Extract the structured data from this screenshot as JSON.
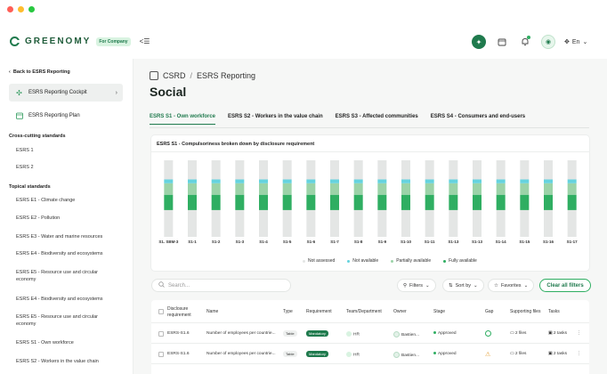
{
  "app": {
    "logo_text": "GREENOMY",
    "plan_badge": "For Company",
    "language": "En",
    "colors": {
      "brand": "#1f7a4d",
      "accent": "#2fae62",
      "light": "#9bd3a8",
      "cyan": "#66d3de",
      "grey": "#e4e6e5"
    }
  },
  "window_controls": {
    "close": "#ff5f57",
    "minimize": "#ffbd2e",
    "maximize": "#28c840"
  },
  "topbar_icons": [
    "ai-assistant-icon",
    "calendar-icon",
    "bell-icon",
    "avatar-icon",
    "globe-icon"
  ],
  "sidebar": {
    "back_label": "Back to ESRS Reporting",
    "cockpit_label": "ESRS Reporting Cockpit",
    "plan_label": "ESRS Reporting Plan",
    "cross_heading": "Cross-cutting standards",
    "cross_items": [
      "ESRS 1",
      "ESRS 2"
    ],
    "topical_heading": "Topical standards",
    "topical_items": [
      "ESRS E1 - Climate change",
      "ESRS E2 - Pollution",
      "ESRS E3 - Water and marine resources",
      "ESRS E4 - Biodiversity and ecosystems",
      "ESRS E5 - Resource use and circular economy",
      "ESRS E4 - Biodiversity and ecosystems",
      "ESRS E5 - Resource use and circular economy",
      "ESRS S1 - Own workforce",
      "ESRS S2 - Workers in the value chain"
    ]
  },
  "main": {
    "breadcrumb_root": "CSRD",
    "breadcrumb_current": "ESRS Reporting",
    "title": "Social",
    "tabs": [
      {
        "label": "ESRS S1 - Own workforce",
        "active": true
      },
      {
        "label": "ESRS S2 - Workers in the value chain",
        "active": false
      },
      {
        "label": "ESRS S3 - Affected communities",
        "active": false
      },
      {
        "label": "ESRS S4 - Consumers and end-users",
        "active": false
      }
    ]
  },
  "chart_data": {
    "type": "bar",
    "stacked": true,
    "title": "ESRS S1 - Compulsoriness broken down by disclosure requirement",
    "categories": [
      "S1. SBM-3",
      "S1-1",
      "S1-2",
      "S1-3",
      "S1-4",
      "S1-5",
      "S1-6",
      "S1-7",
      "S1-8",
      "S1-9",
      "S1-10",
      "S1-11",
      "S1-13",
      "S1-13",
      "S1-14",
      "S1-15",
      "S1-16",
      "S1-17"
    ],
    "series": [
      {
        "name": "Not assessed",
        "color": "#e4e6e5",
        "values": [
          0.35,
          0.35,
          0.35,
          0.35,
          0.35,
          0.35,
          0.35,
          0.35,
          0.35,
          0.35,
          0.35,
          0.35,
          0.35,
          0.35,
          0.35,
          0.35,
          0.35,
          0.35
        ]
      },
      {
        "name": "Fully available",
        "color": "#2fae62",
        "values": [
          0.2,
          0.2,
          0.2,
          0.2,
          0.2,
          0.2,
          0.2,
          0.2,
          0.2,
          0.2,
          0.2,
          0.2,
          0.2,
          0.2,
          0.2,
          0.2,
          0.2,
          0.2
        ]
      },
      {
        "name": "Partially available",
        "color": "#9bd3a8",
        "values": [
          0.15,
          0.15,
          0.15,
          0.15,
          0.15,
          0.15,
          0.15,
          0.15,
          0.15,
          0.15,
          0.15,
          0.15,
          0.15,
          0.15,
          0.15,
          0.15,
          0.15,
          0.15
        ]
      },
      {
        "name": "Not available",
        "color": "#66d3de",
        "values": [
          0.05,
          0.05,
          0.05,
          0.05,
          0.05,
          0.05,
          0.05,
          0.05,
          0.05,
          0.05,
          0.05,
          0.05,
          0.05,
          0.05,
          0.05,
          0.05,
          0.05,
          0.05
        ]
      },
      {
        "name": "Not assessed",
        "color": "#e4e6e5",
        "values": [
          0.25,
          0.25,
          0.25,
          0.25,
          0.25,
          0.25,
          0.25,
          0.25,
          0.25,
          0.25,
          0.25,
          0.25,
          0.25,
          0.25,
          0.25,
          0.25,
          0.25,
          0.25
        ]
      }
    ],
    "legend": [
      "Not assessed",
      "Not available",
      "Partially available",
      "Fully available"
    ],
    "legend_colors": [
      "#e4e6e5",
      "#66d3de",
      "#9bd3a8",
      "#2fae62"
    ],
    "ylim": [
      0,
      1
    ]
  },
  "filters": {
    "search_placeholder": "Search...",
    "filters_label": "Filters",
    "sort_label": "Sort by",
    "favorites_label": "Favorites",
    "clear_label": "Clear all filters"
  },
  "table": {
    "headers": [
      "Disclosure requirement",
      "Name",
      "Type",
      "Requirement",
      "Team/Department",
      "Owner",
      "Stage",
      "Gap",
      "Supporting files",
      "Tasks"
    ],
    "rows": [
      {
        "code": "ESRS-S1.6",
        "name": "Number of employees per countrie...",
        "type": "Table",
        "requirement": "Mandatory",
        "team": "HR",
        "owner": "Bastien...",
        "stage": "Approved",
        "gap": "ok",
        "files": "2 files",
        "tasks": "2 tasks"
      },
      {
        "code": "ESRS-S1.6",
        "name": "Number of employees per countrie...",
        "type": "Table",
        "requirement": "Mandatory",
        "team": "HR",
        "owner": "Bastien...",
        "stage": "Approved",
        "gap": "warn",
        "files": "2 files",
        "tasks": "2 tasks"
      }
    ]
  }
}
